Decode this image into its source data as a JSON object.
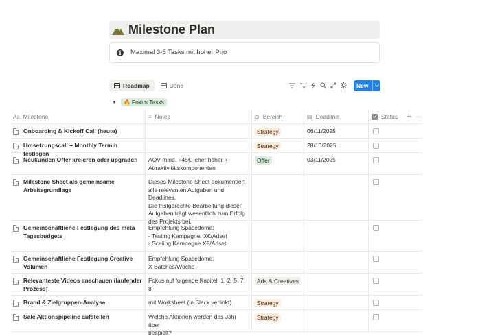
{
  "page": {
    "title": "Milestone Plan",
    "icon": "mountain-icon",
    "callout": "Maximal 3-5 Tasks mit hoher Prio"
  },
  "views": [
    {
      "label": "Roadmap",
      "active": true
    },
    {
      "label": "Done",
      "active": false
    }
  ],
  "toolbar": {
    "icons": [
      "filter-icon",
      "sort-icon",
      "automation-icon",
      "search-icon",
      "expand-icon",
      "settings-icon"
    ],
    "new_label": "New"
  },
  "group": {
    "label": "Fokus Tasks",
    "emoji": "🔥"
  },
  "columns": {
    "milestone": "Milestone",
    "notes": "Notes",
    "bereich": "Bereich",
    "deadline": "Deadline",
    "status": "Status",
    "add": "+",
    "more": "···"
  },
  "colors": {
    "accent": "#2383e2",
    "strategy_bg": "#fbecdd",
    "offer_bg": "#dbeddb",
    "ads_bg": "#efeeeb"
  },
  "rows": [
    {
      "milestone": "Onboarding & Kickoff Call (heute)",
      "notes": "",
      "bereich": "Strategy",
      "deadline": "06/11/2025",
      "done": false
    },
    {
      "milestone": "Umsetzungscall + Monthly Termin festlegen",
      "notes": "",
      "bereich": "Strategy",
      "deadline": "28/10/2025",
      "done": false
    },
    {
      "milestone": "Neukunden Offer kreieren oder upgraden",
      "notes": "AOV mind. +45€, eher höher +\nAttraktivitätskomponenten",
      "bereich": "Offer",
      "deadline": "03/11/2025",
      "done": false
    },
    {
      "milestone": "Milestone Sheet als gemeinsame\nArbeitsgrundlage",
      "notes": "Dieses Milestone Sheet dokumentiert\nalle relevanten Aufgaben und Deadlines.\nDie fristgerechte Bearbeitung dieser\nAufgaben trägt wesentlich zum Erfolg\ndes Projekts bei.",
      "bereich": "",
      "deadline": "",
      "done": false
    },
    {
      "milestone": "Gemeinschaftliche Festlegung des meta\nTagesbudgets",
      "notes": "Empfehlung Spacedome:\n- Testing Kampagne: X€/Adset\n- Scaling Kampagne X€/Adset",
      "bereich": "",
      "deadline": "",
      "done": false
    },
    {
      "milestone": "Gemeinschaftliche Festlegung Creative\nVolumen",
      "notes": "Empfehlung Spacedome:\nX Batches/Woche",
      "bereich": "",
      "deadline": "",
      "done": false
    },
    {
      "milestone": "Relevanteste Videos anschauen (laufender\nProzess)",
      "notes": "Fokus auf folgende Kapitel: 1, 2, 5, 7, 8",
      "bereich": "Ads & Creatives",
      "deadline": "",
      "done": false
    },
    {
      "milestone": "Brand & Zielgruppen-Analyse",
      "notes": "mit Worksheet (in Slack verlinkt)",
      "bereich": "Strategy",
      "deadline": "",
      "done": false
    },
    {
      "milestone": "Sale Aktionspipeline aufstellen",
      "notes": "Welche Aktionen werden das Jahr über\nbespielt?",
      "bereich": "Strategy",
      "deadline": "",
      "done": false
    }
  ]
}
